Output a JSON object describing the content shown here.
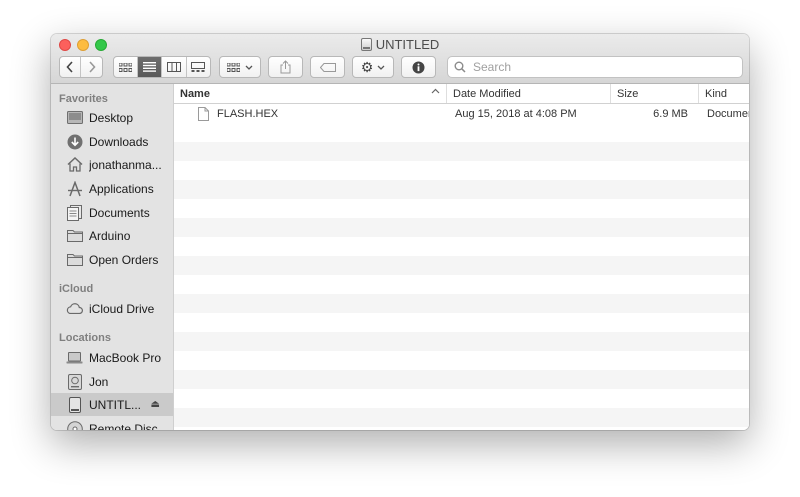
{
  "window": {
    "title": "UNTITLED"
  },
  "toolbar": {
    "search_placeholder": "Search"
  },
  "sidebar": {
    "favorites_header": "Favorites",
    "icloud_header": "iCloud",
    "locations_header": "Locations",
    "favorites": [
      {
        "label": "Desktop",
        "icon": "desktop-icon"
      },
      {
        "label": "Downloads",
        "icon": "downloads-icon"
      },
      {
        "label": "jonathanma...",
        "icon": "home-icon"
      },
      {
        "label": "Applications",
        "icon": "applications-icon"
      },
      {
        "label": "Documents",
        "icon": "documents-icon"
      },
      {
        "label": "Arduino",
        "icon": "folder-icon"
      },
      {
        "label": "Open Orders",
        "icon": "folder-icon"
      }
    ],
    "icloud": [
      {
        "label": "iCloud Drive",
        "icon": "cloud-icon"
      }
    ],
    "locations": [
      {
        "label": "MacBook Pro",
        "icon": "laptop-icon"
      },
      {
        "label": "Jon",
        "icon": "external-drive-icon"
      },
      {
        "label": "UNTITL...",
        "icon": "drive-icon",
        "selected": true
      },
      {
        "label": "Remote Disc",
        "icon": "disc-icon"
      }
    ]
  },
  "list": {
    "columns": {
      "name": "Name",
      "date": "Date Modified",
      "size": "Size",
      "kind": "Kind"
    },
    "rows": [
      {
        "name": "FLASH.HEX",
        "date": "Aug 15, 2018 at 4:08 PM",
        "size": "6.9 MB",
        "kind": "Document"
      }
    ]
  }
}
